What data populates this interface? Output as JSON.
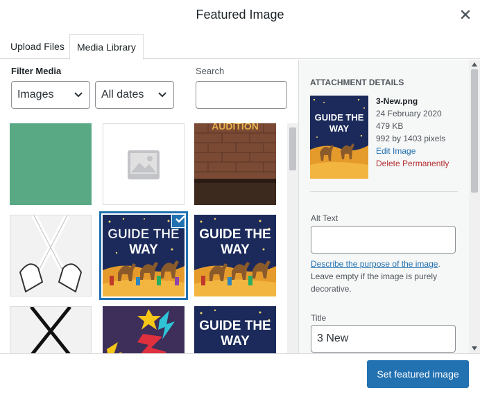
{
  "modal": {
    "title": "Featured Image"
  },
  "tabs": [
    {
      "label": "Upload Files"
    },
    {
      "label": "Media Library"
    }
  ],
  "filters": {
    "label": "Filter Media",
    "type_value": "Images",
    "date_value": "All dates",
    "search_label": "Search",
    "search_value": ""
  },
  "grid": {
    "thumb_texts": {
      "audition": "AUDITION",
      "guide_line1": "GUIDE THE",
      "guide_line2": "WAY"
    }
  },
  "details": {
    "heading": "ATTACHMENT DETAILS",
    "filename": "3-New.png",
    "date": "24 February 2020",
    "size": "479 KB",
    "dimensions": "992 by 1403 pixels",
    "edit_link": "Edit Image",
    "delete_link": "Delete Permanently",
    "alt_label": "Alt Text",
    "alt_value": "",
    "help_link": "Describe the purpose of the image",
    "help_text": ". Leave empty if the image is purely decorative.",
    "title_label": "Title",
    "title_value": "3 New"
  },
  "footer": {
    "primary_label": "Set featured image"
  },
  "colors": {
    "accent": "#2271b1",
    "danger": "#b32d2e",
    "green_tile": "#5aa985",
    "poster_bg": "#1b2a5a",
    "sand": "#e59b2c"
  },
  "icons": {
    "close": "close-icon",
    "chevron": "chevron-down-icon",
    "check": "checkmark-icon",
    "placeholder": "image-placeholder-icon"
  }
}
